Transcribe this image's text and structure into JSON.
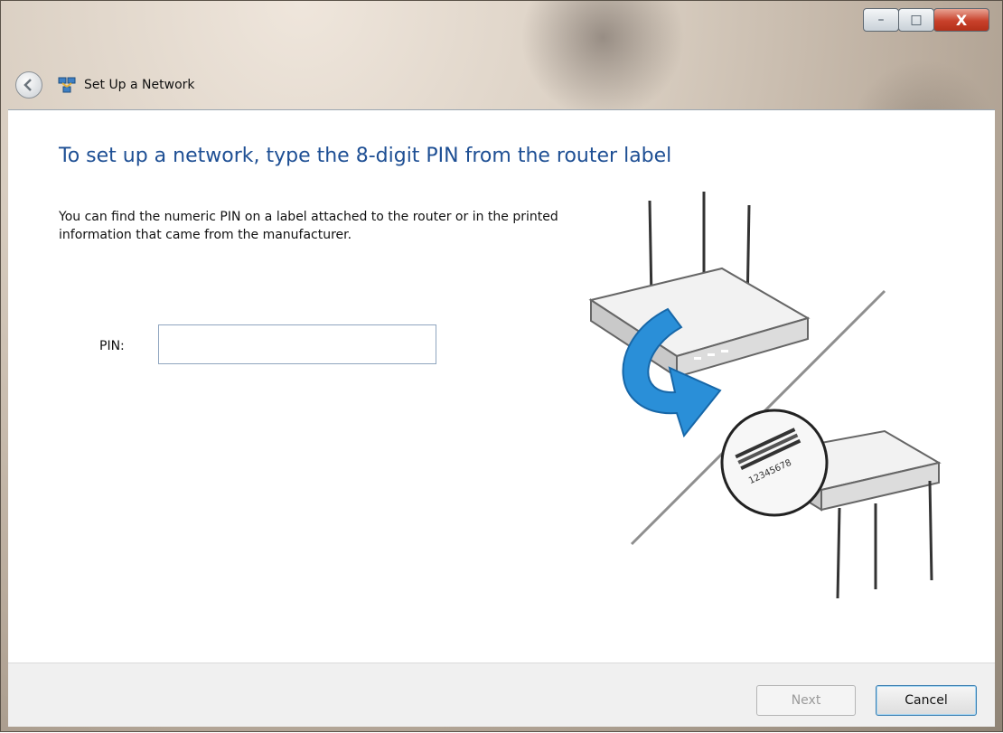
{
  "window": {
    "title": "Set Up a Network",
    "controls": {
      "minimize": "–",
      "maximize": "□",
      "close": "X"
    }
  },
  "content": {
    "heading": "To set up a network, type the 8-digit PIN from the router label",
    "description": "You can find the numeric PIN on a label attached to the router or in the printed information that came from the manufacturer.",
    "pin": {
      "label": "PIN:",
      "value": "",
      "placeholder": ""
    },
    "router_label_number": "12345678"
  },
  "footer": {
    "next_label": "Next",
    "cancel_label": "Cancel"
  },
  "colors": {
    "heading": "#1e4f94",
    "arrow": "#2a8fd8",
    "close": "#c8412b"
  }
}
